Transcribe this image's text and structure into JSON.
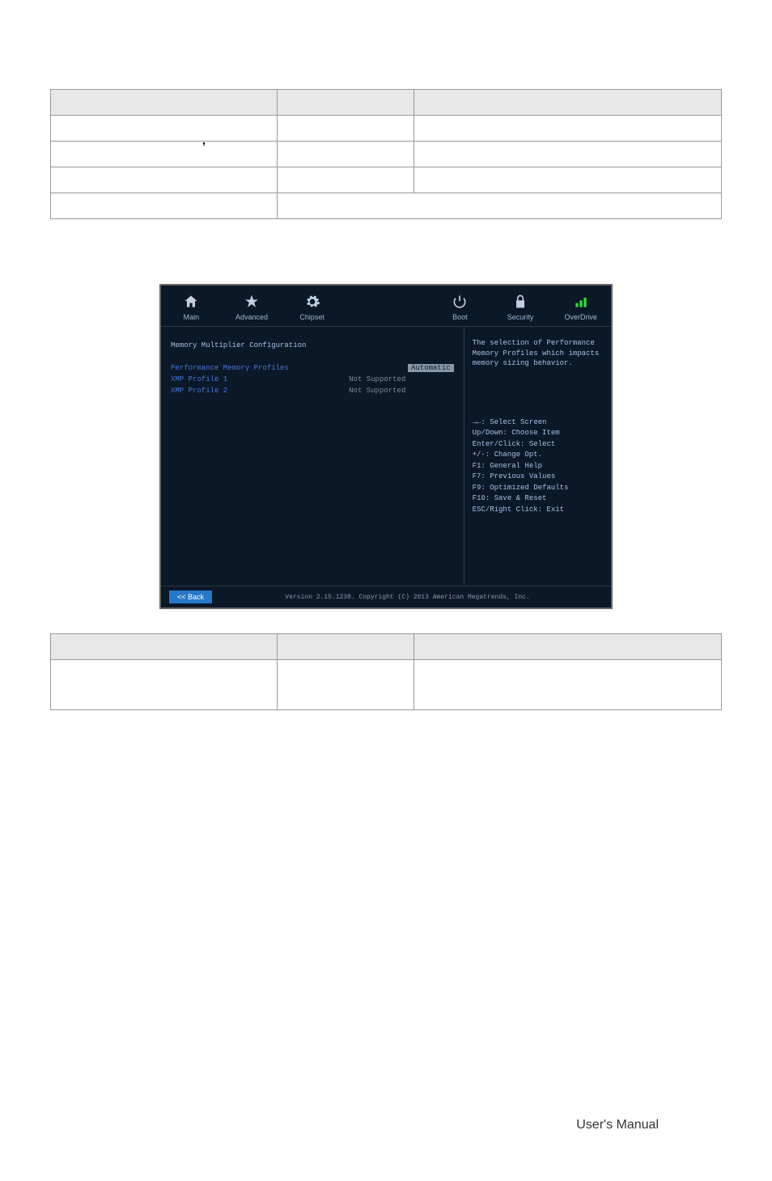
{
  "comma": ",",
  "table1": {
    "headers": [
      "",
      "",
      ""
    ],
    "rows": [
      [
        "",
        "",
        ""
      ],
      [
        "",
        "",
        ""
      ],
      [
        "",
        "",
        ""
      ]
    ],
    "lastRow": [
      "",
      ""
    ]
  },
  "bios": {
    "tabs": {
      "main": "Main",
      "advanced": "Advanced",
      "chipset": "Chipset",
      "boot": "Boot",
      "security": "Security",
      "overdrive": "OverDrive"
    },
    "section_title": "Memory Multiplier Configuration",
    "items": [
      {
        "label": "Performance Memory Profiles",
        "value": "Automatic",
        "selected": true
      },
      {
        "label": "XMP Profile 1",
        "value": "Not Supported",
        "selected": false
      },
      {
        "label": "XMP Profile 2",
        "value": "Not Supported",
        "selected": false
      }
    ],
    "help_text": "The selection of Performance Memory Profiles which impacts memory sizing behavior.",
    "nav": [
      "→←: Select Screen",
      "Up/Down: Choose Item",
      "Enter/Click: Select",
      "+/-: Change Opt.",
      "F1:  General Help",
      "F7:  Previous Values",
      "F9:  Optimized Defaults",
      "F10: Save & Reset",
      "ESC/Right Click: Exit"
    ],
    "back_btn": "<< Back",
    "footer_version": "Version 2.15.1238. Copyright (C) 2013 American Megatrends, Inc."
  },
  "table2": {
    "headers": [
      "",
      "",
      ""
    ],
    "rows": [
      [
        "",
        "",
        ""
      ]
    ]
  },
  "page_footer": "User's Manual"
}
